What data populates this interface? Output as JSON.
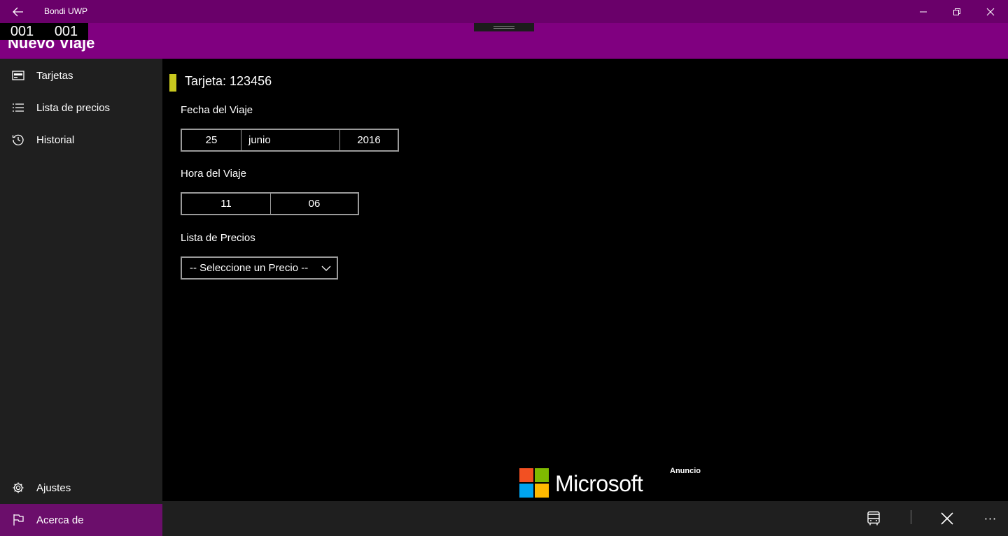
{
  "window": {
    "title": "Bondi UWP",
    "back_icon": "back-arrow-icon",
    "minimize_icon": "minimize-icon",
    "restore_icon": "restore-icon",
    "close_icon": "close-icon"
  },
  "header": {
    "page_title": "Nuevo Viaje",
    "counter": [
      "001",
      "001"
    ]
  },
  "sidebar": {
    "items": [
      {
        "label": "Tarjetas",
        "icon": "card-icon"
      },
      {
        "label": "Lista de precios",
        "icon": "list-icon"
      },
      {
        "label": "Historial",
        "icon": "history-icon"
      }
    ],
    "footer_items": [
      {
        "label": "Ajustes",
        "icon": "gear-icon"
      },
      {
        "label": "Acerca de",
        "icon": "flag-icon",
        "active": true
      }
    ]
  },
  "main": {
    "card_title": "Tarjeta: 123456",
    "date_label": "Fecha del Viaje",
    "date": {
      "day": "25",
      "month": "junio",
      "year": "2016"
    },
    "time_label": "Hora del Viaje",
    "time": {
      "hour": "11",
      "minute": "06"
    },
    "price_label": "Lista de Precios",
    "price_select": "-- Seleccione un Precio --"
  },
  "ad": {
    "brand": "Microsoft",
    "label": "Anuncio"
  },
  "commandbar": {
    "buttons": [
      "bus-icon",
      "cancel-icon",
      "more-icon"
    ],
    "more_label": "···"
  },
  "colors": {
    "titlebar": "#6a006a",
    "header": "#800080",
    "sidebar": "#1f1f1f",
    "active_nav": "#6b0e6b",
    "card_accent": "#c8c81e"
  }
}
